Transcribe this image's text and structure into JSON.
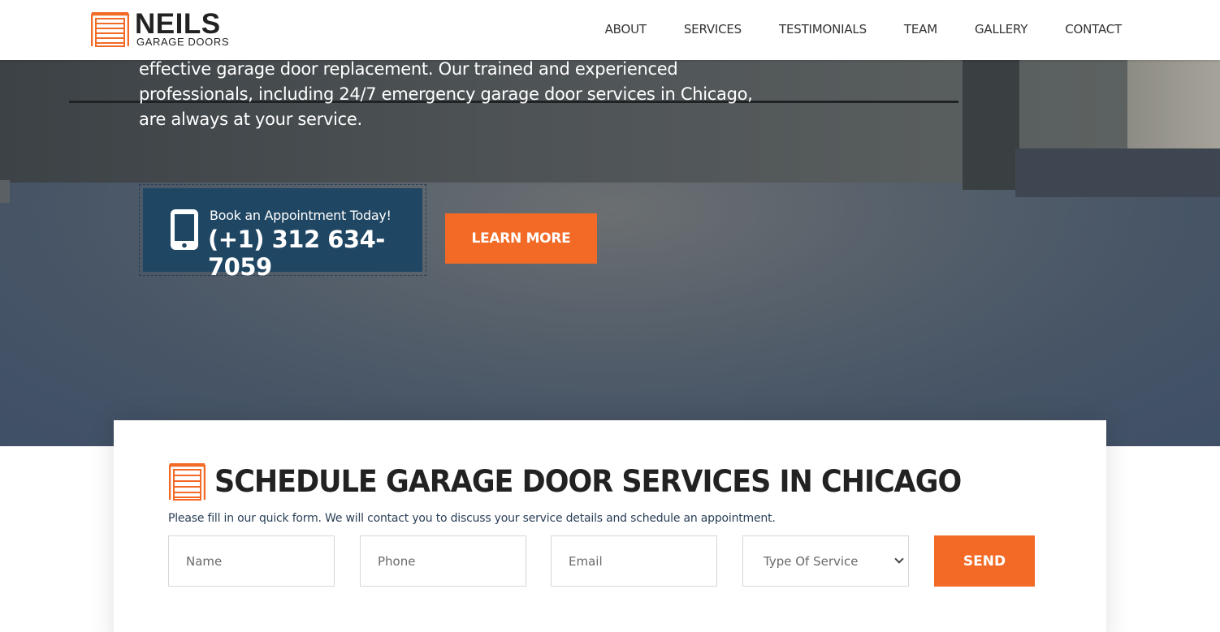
{
  "brand": {
    "name": "NEILS",
    "tagline": "GARAGE DOORS",
    "accent": "#f26a26",
    "navy": "#1f4663"
  },
  "nav": {
    "items": [
      {
        "label": "ABOUT"
      },
      {
        "label": "SERVICES"
      },
      {
        "label": "TESTIMONIALS"
      },
      {
        "label": "TEAM"
      },
      {
        "label": "GALLERY"
      },
      {
        "label": "CONTACT"
      }
    ]
  },
  "hero": {
    "text": "effective garage door replacement. Our trained and experienced professionals, including 24/7 emergency garage door services in Chicago, are always at your service.",
    "book_label": "Book an Appointment Today!",
    "book_phone": "(+1) 312 634-7059",
    "learn_more": "LEARN MORE",
    "icon": "mobile-phone-icon"
  },
  "form": {
    "title": "SCHEDULE GARAGE DOOR SERVICES IN CHICAGO",
    "description": "Please fill in our quick form. We will contact you to discuss your service details and schedule an appointment.",
    "name_placeholder": "Name",
    "phone_placeholder": "Phone",
    "email_placeholder": "Email",
    "service_selected": "Type Of Service",
    "send_label": "SEND",
    "icon": "garage-door-icon"
  }
}
